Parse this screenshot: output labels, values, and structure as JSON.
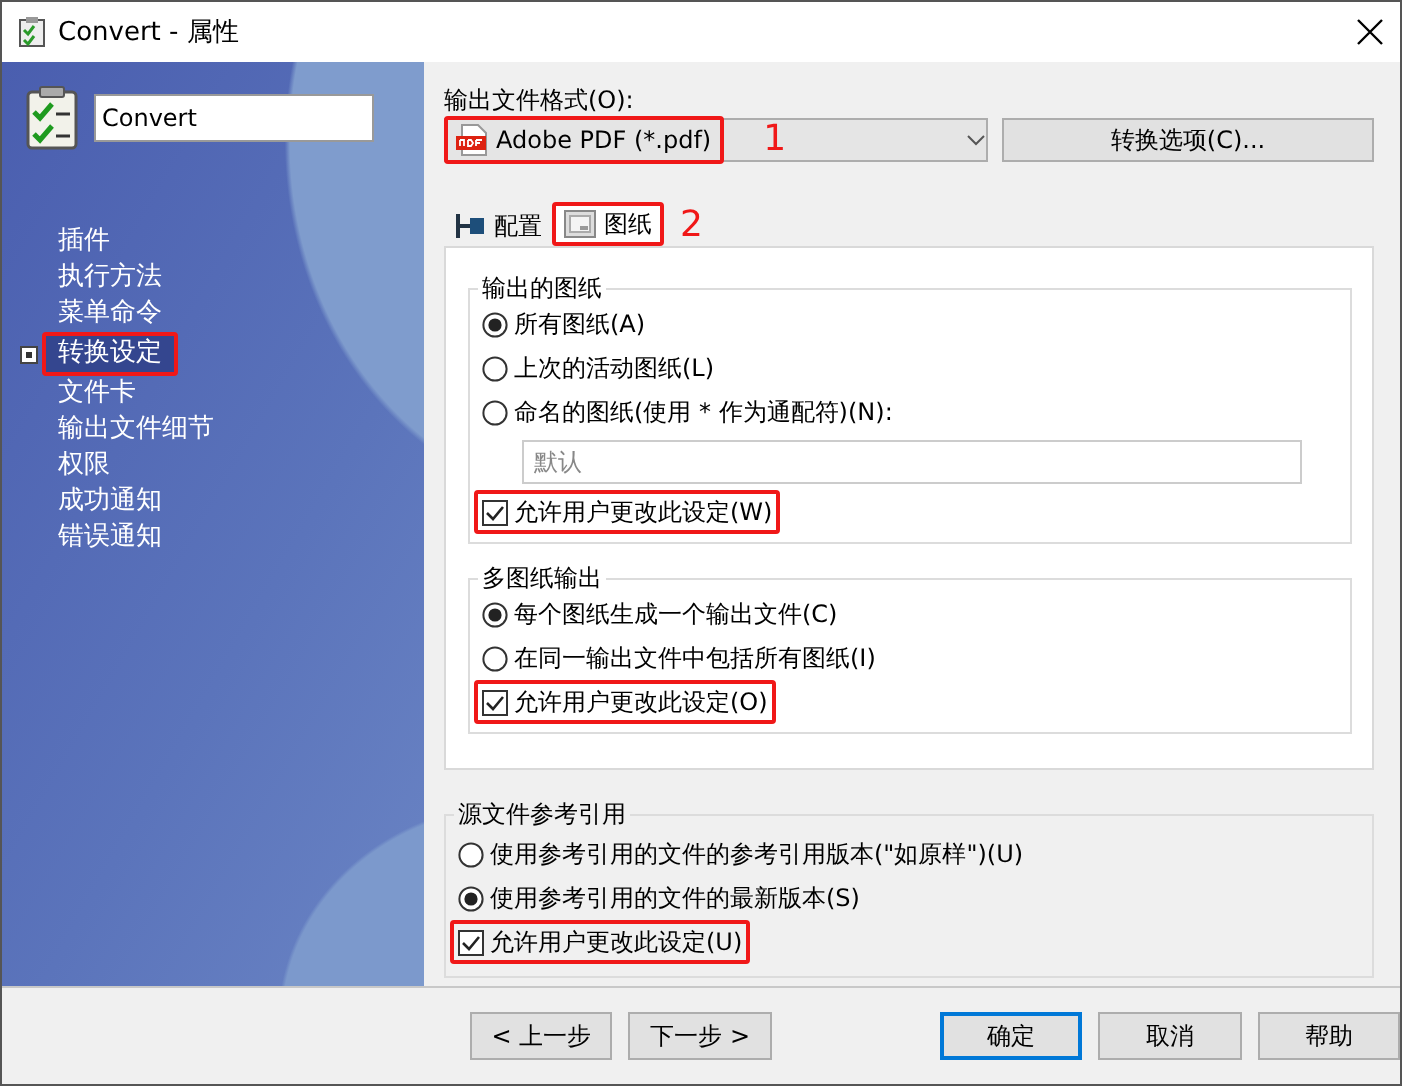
{
  "window": {
    "title": "Convert - 属性"
  },
  "sidebar": {
    "name_field": {
      "value": "Convert"
    },
    "items": [
      {
        "label": "插件",
        "selected": false,
        "highlighted": false
      },
      {
        "label": "执行方法",
        "selected": false,
        "highlighted": false
      },
      {
        "label": "菜单命令",
        "selected": false,
        "highlighted": false
      },
      {
        "label": "转换设定",
        "selected": true,
        "highlighted": true
      },
      {
        "label": "文件卡",
        "selected": false,
        "highlighted": false
      },
      {
        "label": "输出文件细节",
        "selected": false,
        "highlighted": false
      },
      {
        "label": "权限",
        "selected": false,
        "highlighted": false
      },
      {
        "label": "成功通知",
        "selected": false,
        "highlighted": false
      },
      {
        "label": "错误通知",
        "selected": false,
        "highlighted": false
      }
    ]
  },
  "output_format": {
    "label": "输出文件格式(O):",
    "value": "Adobe PDF (*.pdf)",
    "highlighted": true,
    "annotation": "1"
  },
  "convert_options_button": "转换选项(C)...",
  "tabs": [
    {
      "label": "配置",
      "selected": false,
      "highlighted": false
    },
    {
      "label": "图纸",
      "selected": true,
      "highlighted": true,
      "annotation": "2"
    }
  ],
  "tab_groups": [
    {
      "title": "输出的图纸",
      "options": [
        {
          "kind": "radio",
          "label": "所有图纸(A)",
          "selected": true
        },
        {
          "kind": "radio",
          "label": "上次的活动图纸(L)",
          "selected": false
        },
        {
          "kind": "radio",
          "label": "命名的图纸(使用 * 作为通配符)(N):",
          "selected": false
        },
        {
          "kind": "field",
          "placeholder": "默认"
        },
        {
          "kind": "checkbox",
          "label": "允许用户更改此设定(W)",
          "checked": true,
          "highlighted": true
        }
      ]
    },
    {
      "title": "多图纸输出",
      "options": [
        {
          "kind": "radio",
          "label": "每个图纸生成一个输出文件(C)",
          "selected": true
        },
        {
          "kind": "radio",
          "label": "在同一输出文件中包括所有图纸(I)",
          "selected": false
        },
        {
          "kind": "checkbox",
          "label": "允许用户更改此设定(O)",
          "checked": true,
          "highlighted": true
        }
      ]
    }
  ],
  "source_group": {
    "title": "源文件参考引用",
    "options": [
      {
        "kind": "radio",
        "label": "使用参考引用的文件的参考引用版本(\"如原样\")(U)",
        "selected": false
      },
      {
        "kind": "radio",
        "label": "使用参考引用的文件的最新版本(S)",
        "selected": true
      },
      {
        "kind": "checkbox",
        "label": "允许用户更改此设定(U)",
        "checked": true,
        "highlighted": true
      }
    ]
  },
  "buttons": [
    {
      "label": "< 上一步",
      "kind": "nav",
      "focused": false
    },
    {
      "label": "下一步 >",
      "kind": "nav",
      "focused": false
    },
    {
      "label": "确定",
      "kind": "action",
      "focused": true
    },
    {
      "label": "取消",
      "kind": "action",
      "focused": false
    },
    {
      "label": "帮助",
      "kind": "action",
      "focused": false
    }
  ]
}
